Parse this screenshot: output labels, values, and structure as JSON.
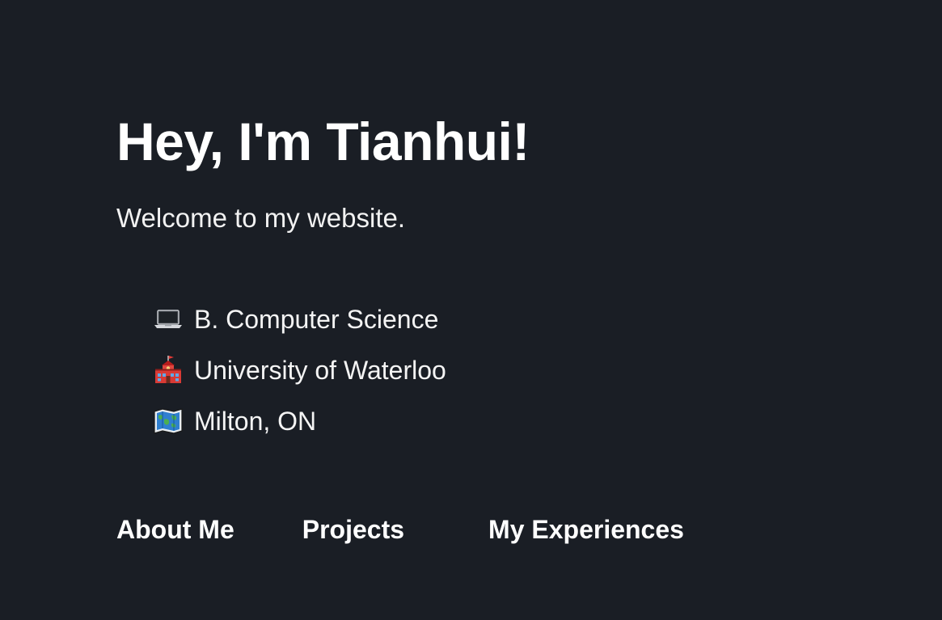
{
  "hero": {
    "title": "Hey, I'm Tianhui!",
    "subtitle": "Welcome to my website."
  },
  "facts": [
    {
      "icon": "laptop-icon",
      "label": "B. Computer Science"
    },
    {
      "icon": "school-icon",
      "label": "University of Waterloo"
    },
    {
      "icon": "world-map-icon",
      "label": "Milton, ON"
    }
  ],
  "nav": {
    "about": "About Me",
    "projects": "Projects",
    "experiences": "My Experiences"
  },
  "colors": {
    "background": "#1a1e25",
    "text": "#ffffff"
  }
}
